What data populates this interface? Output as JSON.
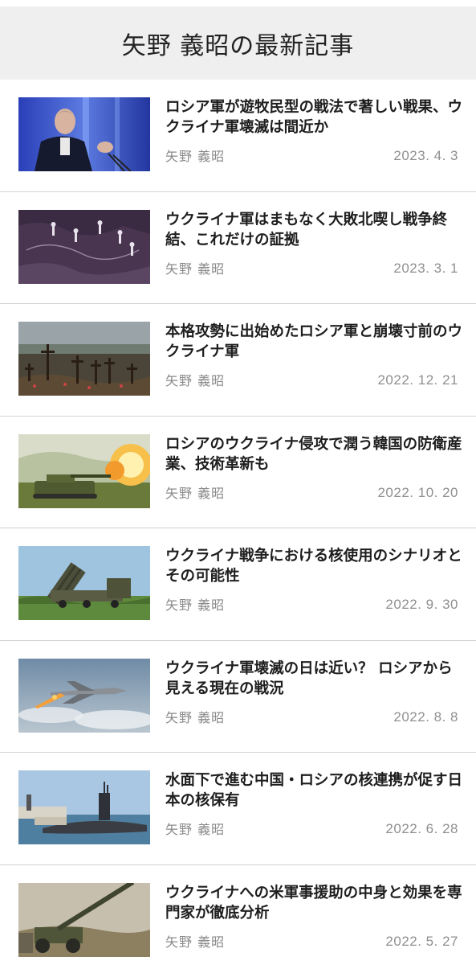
{
  "header": {
    "title": "矢野  義昭の最新記事"
  },
  "articles": [
    {
      "title": "ロシア軍が遊牧民型の戦法で著しい戦果、ウクライナ軍壊滅は間近か",
      "author": "矢野  義昭",
      "date": "2023. 4. 3",
      "thumbnail": "speaker-at-podium-photo"
    },
    {
      "title": "ウクライナ軍はまもなく大敗北喫し戦争終結、これだけの証拠",
      "author": "矢野  義昭",
      "date": "2023. 3. 1",
      "thumbnail": "map-with-chess-pieces-photo"
    },
    {
      "title": "本格攻勢に出始めたロシア軍と崩壊寸前のウクライナ軍",
      "author": "矢野  義昭",
      "date": "2022. 12. 21",
      "thumbnail": "cemetery-crosses-photo"
    },
    {
      "title": "ロシアのウクライナ侵攻で潤う韓国の防衛産業、技術革新も",
      "author": "矢野  義昭",
      "date": "2022. 10. 20",
      "thumbnail": "howitzer-firing-photo"
    },
    {
      "title": "ウクライナ戦争における核使用のシナリオとその可能性",
      "author": "矢野  義昭",
      "date": "2022. 9. 30",
      "thumbnail": "rocket-launcher-photo"
    },
    {
      "title": "ウクライナ軍壊滅の日は近い？  ロシアから見える現在の戦況",
      "author": "矢野  義昭",
      "date": "2022. 8. 8",
      "thumbnail": "fighter-jet-photo"
    },
    {
      "title": "水面下で進む中国・ロシアの核連携が促す日本の核保有",
      "author": "矢野  義昭",
      "date": "2022. 6. 28",
      "thumbnail": "submarine-in-port-photo"
    },
    {
      "title": "ウクライナへの米軍事援助の中身と効果を専門家が徹底分析",
      "author": "矢野  義昭",
      "date": "2022. 5. 27",
      "thumbnail": "artillery-gun-photo"
    }
  ]
}
